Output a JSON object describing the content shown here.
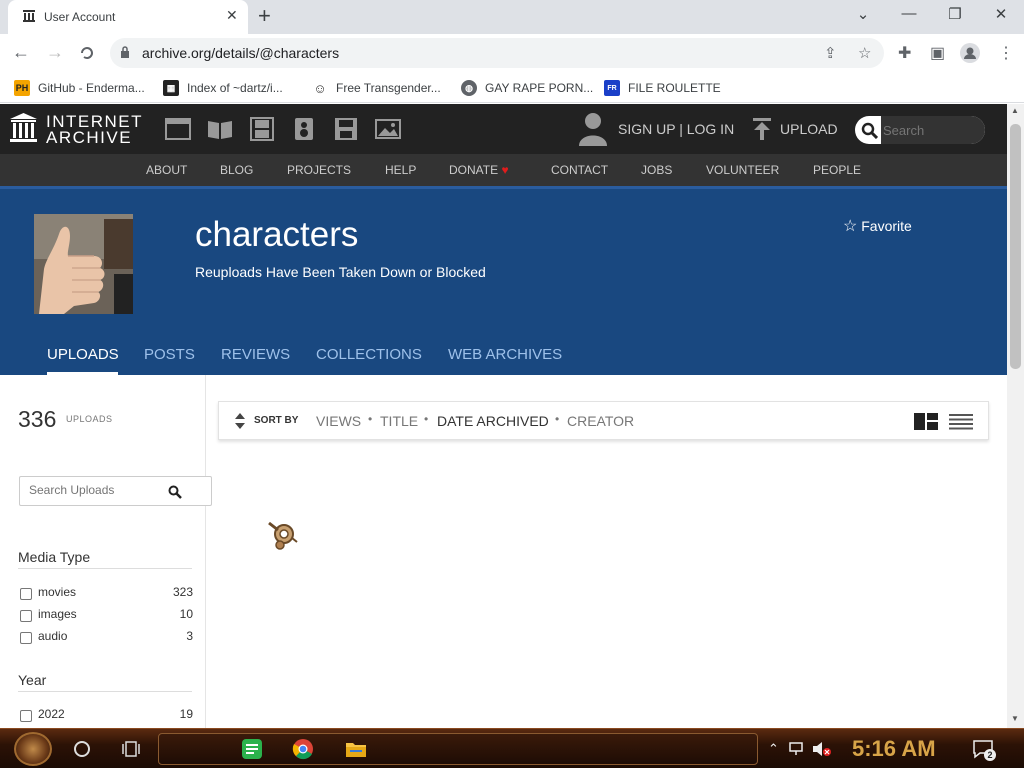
{
  "browser": {
    "tab_title": "User Account",
    "url": "archive.org/details/@characters",
    "bookmarks": [
      {
        "label": "GitHub - Enderma...",
        "icon": "ph-icon"
      },
      {
        "label": "Index of ~dartz/i...",
        "icon": "index-icon"
      },
      {
        "label": "Free Transgender...",
        "icon": "mask-icon"
      },
      {
        "label": "GAY RAPE PORN...",
        "icon": "globe-icon"
      },
      {
        "label": "FILE ROULETTE",
        "icon": "file-roulette-icon"
      }
    ],
    "colors": {
      "tabstrip": "#dee1e6",
      "omnibox": "#f1f3f4"
    }
  },
  "ia": {
    "logo_line1": "INTERNET",
    "logo_line2": "ARCHIVE",
    "signup": "SIGN UP | LOG IN",
    "upload": "UPLOAD",
    "search_placeholder": "Search",
    "menu": [
      "ABOUT",
      "BLOG",
      "PROJECTS",
      "HELP",
      "DONATE",
      "CONTACT",
      "JOBS",
      "VOLUNTEER",
      "PEOPLE"
    ],
    "colors": {
      "header": "#222222",
      "menu": "#333333",
      "banner": "#194880",
      "donate_heart": "#e01c1c"
    }
  },
  "profile": {
    "name": "characters",
    "description": "Reuploads Have Been Taken Down or Blocked",
    "favorite_label": "Favorite",
    "tabs": [
      "UPLOADS",
      "POSTS",
      "REVIEWS",
      "COLLECTIONS",
      "WEB ARCHIVES"
    ],
    "active_tab": "UPLOADS"
  },
  "uploads": {
    "count": "336",
    "count_label": "UPLOADS",
    "search_placeholder": "Search Uploads"
  },
  "filters": {
    "media_type_heading": "Media Type",
    "media_types": [
      {
        "label": "movies",
        "count": "323"
      },
      {
        "label": "images",
        "count": "10"
      },
      {
        "label": "audio",
        "count": "3"
      }
    ],
    "year_heading": "Year",
    "years": [
      {
        "label": "2022",
        "count": "19"
      }
    ]
  },
  "sort": {
    "label": "SORT BY",
    "options": [
      "VIEWS",
      "TITLE",
      "DATE ARCHIVED",
      "CREATOR"
    ],
    "active": "DATE ARCHIVED"
  },
  "taskbar": {
    "clock": "5:16 AM",
    "notification_count": "2"
  }
}
